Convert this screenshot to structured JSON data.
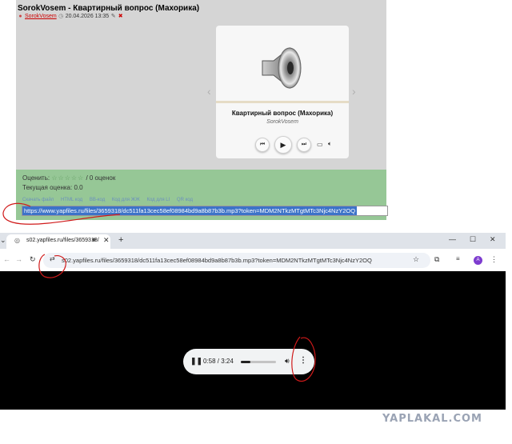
{
  "post": {
    "title": "SorokVosem - Квартирный вопрос (Махорика)",
    "author": "SorokVosem",
    "date": "20.04.2026 13:35"
  },
  "player": {
    "track_title": "Квартирный вопрос (Махорика)",
    "track_author": "SorokVosem",
    "prev_icon": "skip-back-icon",
    "play_icon": "play-icon",
    "next_icon": "skip-forward-icon"
  },
  "rating": {
    "label": "Оценить:",
    "stars": "☆☆☆☆☆",
    "count": "/ 0 оценок",
    "current": "Текущая оценка: 0.0"
  },
  "code_links": [
    "Скачать файл",
    "HTML код",
    "BB-код",
    "Код для ЖЖ",
    "Код для LI",
    "QR код"
  ],
  "selected_url": "https://www.yapfiles.ru/files/3659318/dc511fa13cec58ef08984bd9a8b87b3b.mp3?token=MDM2NTkzMTgtMTc3Njc4NzY2OQ",
  "browser": {
    "tab_title": "s02.yapfiles.ru/files/3659318/",
    "address": "s02.yapfiles.ru/files/3659318/dc511fa13cec58ef08984bd9a8b87b3b.mp3?token=MDM2NTkzMTgtMTc3Njc4NzY2OQ",
    "avatar_letter": "A"
  },
  "audio": {
    "time": "0:58 / 3:24",
    "progress": 0.28
  },
  "watermark": "YAPLAKAL.COM",
  "colors": {
    "page_bg": "#d5d5d5",
    "green_panel": "#96c796",
    "selection": "#3d73c8",
    "annotation_red": "#d01a1a",
    "viewport_bg": "#000000"
  }
}
